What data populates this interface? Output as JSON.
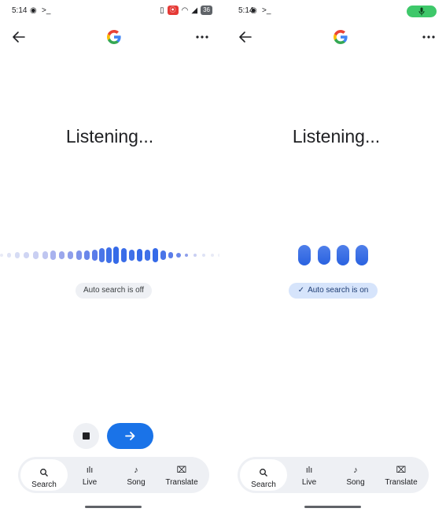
{
  "colors": {
    "accent": "#1a73e8",
    "chip_on": "#d6e4fb",
    "chip_off": "#eef0f4",
    "mic_active": "#3ec86a"
  },
  "panels": [
    {
      "status": {
        "time": "5:14",
        "battery": "36"
      },
      "title": "Listening...",
      "chip": "Auto search is off",
      "nav": [
        "Search",
        "Live",
        "Song",
        "Translate"
      ]
    },
    {
      "status": {
        "time": "5:14"
      },
      "title": "Listening...",
      "chip": "Auto search is on",
      "nav": [
        "Search",
        "Live",
        "Song",
        "Translate"
      ]
    }
  ],
  "icons": [
    "back-arrow-icon",
    "google-logo-icon",
    "more-options-icon",
    "stop-icon",
    "arrow-right-icon",
    "search-icon",
    "live-icon",
    "song-icon",
    "translate-icon",
    "mic-icon"
  ]
}
